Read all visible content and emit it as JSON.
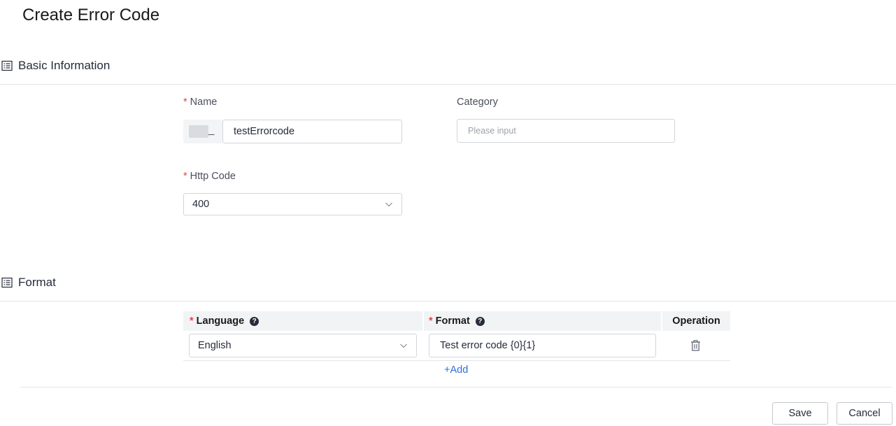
{
  "page": {
    "title": "Create Error Code"
  },
  "basic_info": {
    "heading": "Basic Information",
    "name": {
      "required": "*",
      "label": "Name",
      "prefix_separator": "_",
      "value": "testErrorcode"
    },
    "category": {
      "label": "Category",
      "placeholder": "Please input"
    },
    "http_code": {
      "required": "*",
      "label": "Http Code",
      "value": "400"
    }
  },
  "format": {
    "heading": "Format",
    "columns": {
      "language": {
        "required": "*",
        "label": "Language"
      },
      "format": {
        "required": "*",
        "label": "Format"
      },
      "operation": {
        "label": "Operation"
      }
    },
    "rows": [
      {
        "language": "English",
        "format": "Test error code {0}{1}"
      }
    ],
    "add_label": "+Add"
  },
  "footer": {
    "save_label": "Save",
    "cancel_label": "Cancel"
  },
  "colors": {
    "required": "#e54545",
    "link": "#2f6fe0",
    "border": "#d3d5da",
    "header_bg": "#f2f3f5"
  },
  "icons": {
    "section": "list-icon",
    "help": "question-circle-icon",
    "dropdown": "chevron-down-icon",
    "delete": "trash-icon"
  }
}
